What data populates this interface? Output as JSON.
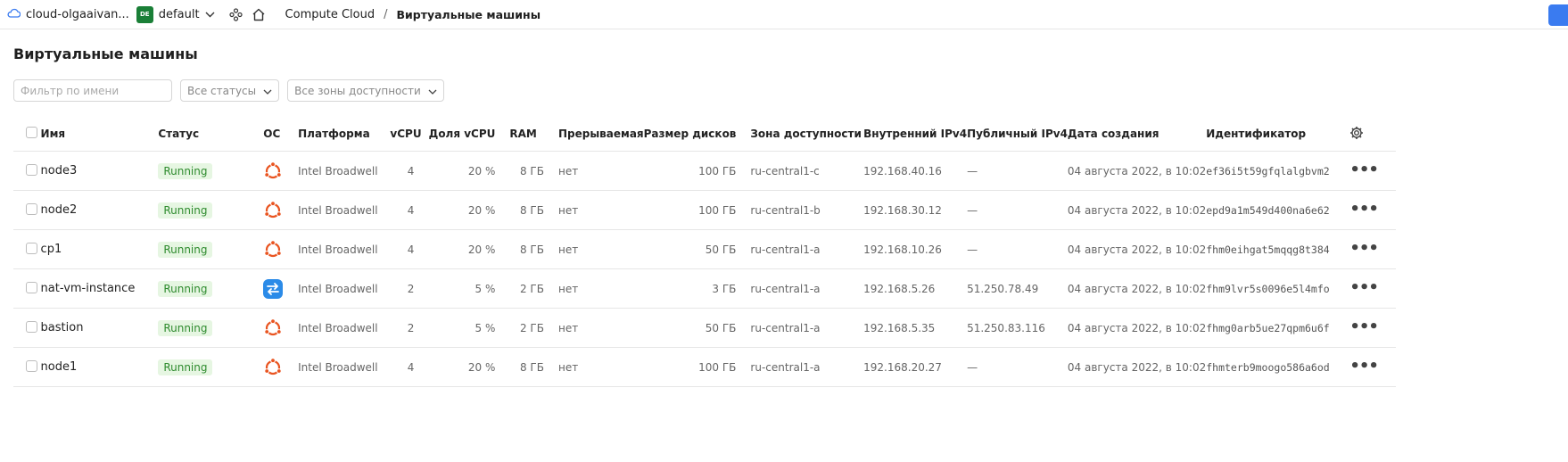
{
  "topbar": {
    "cloud_label": "cloud-olgaaivan...",
    "folder_badge": "DE",
    "folder_label": "default",
    "breadcrumb": {
      "service": "Compute Cloud",
      "separator": "/",
      "current": "Виртуальные машины"
    }
  },
  "page": {
    "title": "Виртуальные машины"
  },
  "filters": {
    "name_placeholder": "Фильтр по имени",
    "status_label": "Все статусы",
    "zone_label": "Все зоны доступности"
  },
  "table": {
    "headers": {
      "name": "Имя",
      "status": "Статус",
      "os": "ОС",
      "platform": "Платформа",
      "vcpu": "vCPU",
      "vcpu_share": "Доля vCPU",
      "ram": "RAM",
      "preemptible": "Прерываемая",
      "disk": "Размер дисков",
      "zone": "Зона доступности",
      "ipv4_int": "Внутренний IPv4",
      "ipv4_pub": "Публичный IPv4",
      "created": "Дата создания",
      "id": "Идентификатор"
    },
    "rows": [
      {
        "name": "node3",
        "status": "Running",
        "os": "ubuntu",
        "platform": "Intel Broadwell",
        "vcpu": "4",
        "vcpu_share": "20 %",
        "ram": "8 ГБ",
        "preemptible": "нет",
        "disk": "100 ГБ",
        "zone": "ru-central1-c",
        "ipv4_int": "192.168.40.16",
        "ipv4_pub": "—",
        "created": "04 августа 2022, в 10:02",
        "id": "ef36i5t59gfqlalgbvm2"
      },
      {
        "name": "node2",
        "status": "Running",
        "os": "ubuntu",
        "platform": "Intel Broadwell",
        "vcpu": "4",
        "vcpu_share": "20 %",
        "ram": "8 ГБ",
        "preemptible": "нет",
        "disk": "100 ГБ",
        "zone": "ru-central1-b",
        "ipv4_int": "192.168.30.12",
        "ipv4_pub": "—",
        "created": "04 августа 2022, в 10:02",
        "id": "epd9a1m549d400na6e62"
      },
      {
        "name": "cp1",
        "status": "Running",
        "os": "ubuntu",
        "platform": "Intel Broadwell",
        "vcpu": "4",
        "vcpu_share": "20 %",
        "ram": "8 ГБ",
        "preemptible": "нет",
        "disk": "50 ГБ",
        "zone": "ru-central1-a",
        "ipv4_int": "192.168.10.26",
        "ipv4_pub": "—",
        "created": "04 августа 2022, в 10:02",
        "id": "fhm0eihgat5mqqg8t384"
      },
      {
        "name": "nat-vm-instance",
        "status": "Running",
        "os": "nat",
        "platform": "Intel Broadwell",
        "vcpu": "2",
        "vcpu_share": "5 %",
        "ram": "2 ГБ",
        "preemptible": "нет",
        "disk": "3 ГБ",
        "zone": "ru-central1-a",
        "ipv4_int": "192.168.5.26",
        "ipv4_pub": "51.250.78.49",
        "created": "04 августа 2022, в 10:02",
        "id": "fhm9lvr5s0096e5l4mfo"
      },
      {
        "name": "bastion",
        "status": "Running",
        "os": "ubuntu",
        "platform": "Intel Broadwell",
        "vcpu": "2",
        "vcpu_share": "5 %",
        "ram": "2 ГБ",
        "preemptible": "нет",
        "disk": "50 ГБ",
        "zone": "ru-central1-a",
        "ipv4_int": "192.168.5.35",
        "ipv4_pub": "51.250.83.116",
        "created": "04 августа 2022, в 10:02",
        "id": "fhmg0arb5ue27qpm6u6f"
      },
      {
        "name": "node1",
        "status": "Running",
        "os": "ubuntu",
        "platform": "Intel Broadwell",
        "vcpu": "4",
        "vcpu_share": "20 %",
        "ram": "8 ГБ",
        "preemptible": "нет",
        "disk": "100 ГБ",
        "zone": "ru-central1-a",
        "ipv4_int": "192.168.20.27",
        "ipv4_pub": "—",
        "created": "04 августа 2022, в 10:02",
        "id": "fhmterb9moogo586a6od"
      }
    ]
  },
  "colors": {
    "accent": "#3a7bf0",
    "status_bg": "#e6f6e2",
    "status_fg": "#2e8b2e",
    "ubuntu": "#e95420",
    "folder_badge": "#1a7f37"
  }
}
